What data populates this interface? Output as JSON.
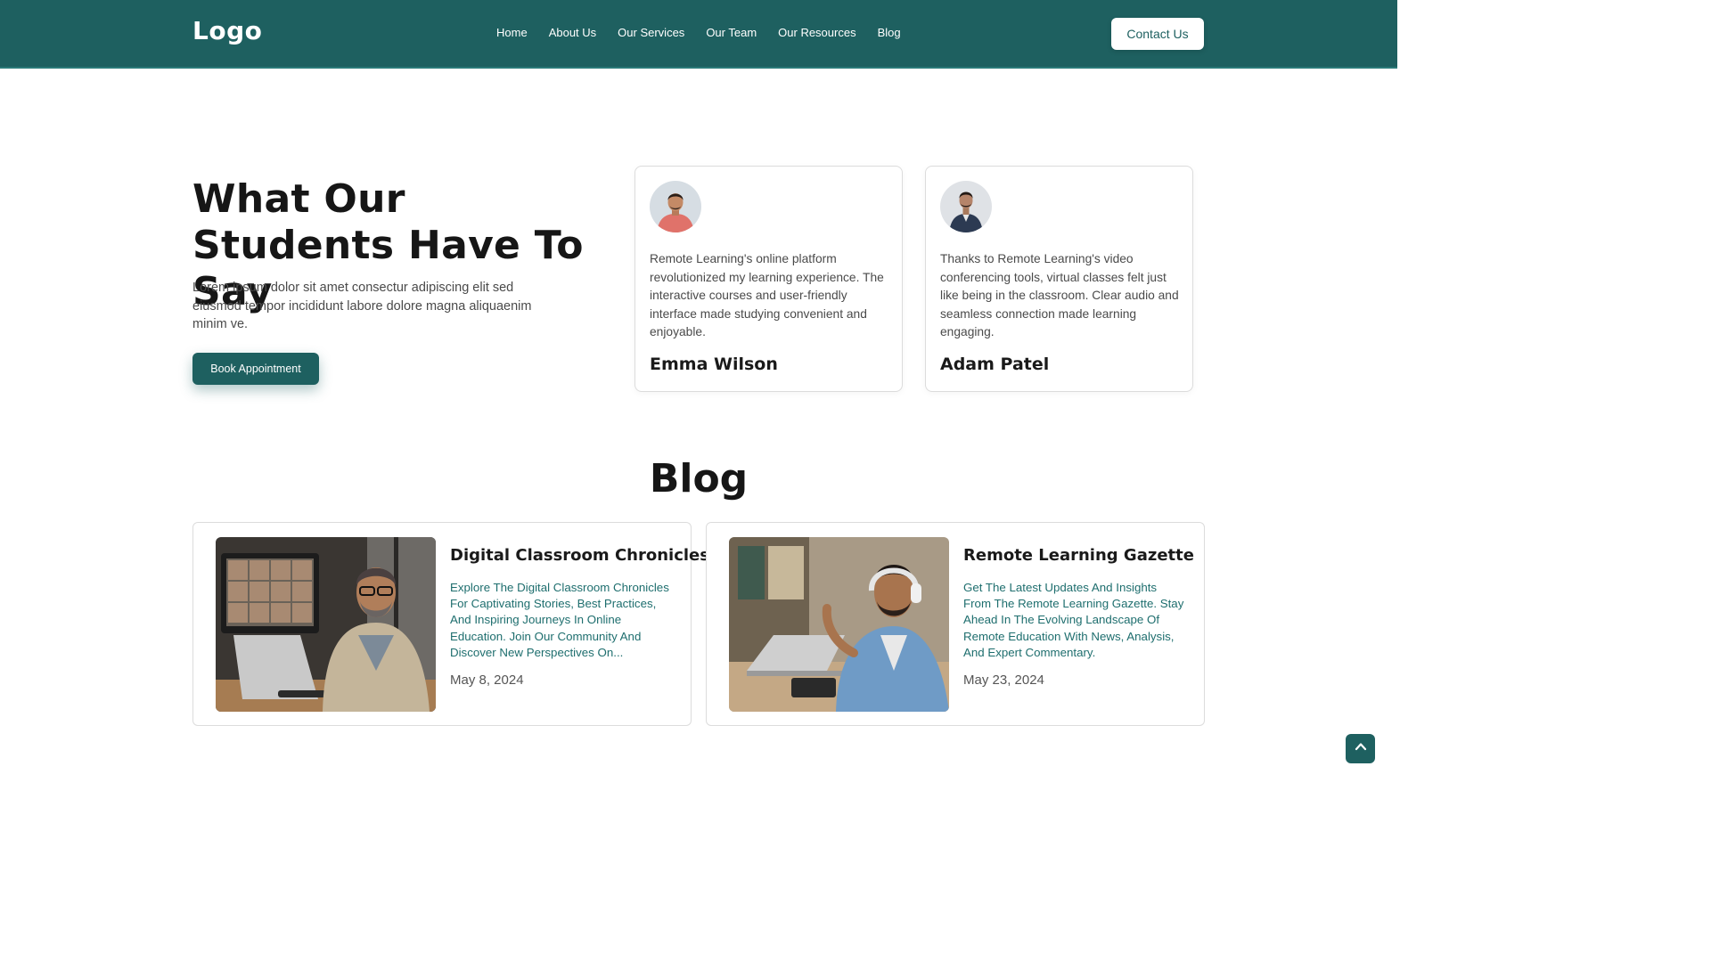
{
  "header": {
    "logo": "Logo",
    "nav": [
      "Home",
      "About Us",
      "Our Services",
      "Our Team",
      "Our Resources",
      "Blog"
    ],
    "contact_label": "Contact Us"
  },
  "testimonials": {
    "title": "What Our Students Have To Say",
    "description": "Lorem ipsum dolor sit amet consectur adipiscing elit sed eiusmod tempor incididunt labore dolore magna aliquaenim minim ve.",
    "button_label": "Book Appointment",
    "items": [
      {
        "quote": "Remote Learning's online platform revolutionized my learning experience. The interactive courses and user-friendly interface made studying convenient and enjoyable.",
        "name": "Emma Wilson"
      },
      {
        "quote": "Thanks to Remote Learning's video conferencing tools, virtual classes felt just like being in the classroom. Clear audio and seamless connection made learning engaging.",
        "name": "Adam Patel"
      }
    ]
  },
  "blog": {
    "title": "Blog",
    "posts": [
      {
        "title": "Digital Classroom Chronicles",
        "excerpt": "Explore The Digital Classroom Chronicles For Captivating Stories, Best Practices, And Inspiring Journeys In Online Education. Join Our Community And Discover New Perspectives On...",
        "date": "May 8, 2024"
      },
      {
        "title": "Remote Learning Gazette",
        "excerpt": "Get The Latest Updates And Insights From The Remote Learning Gazette. Stay Ahead In The Evolving Landscape Of Remote Education With News, Analysis, And Expert Commentary.",
        "date": "May 23, 2024"
      }
    ]
  },
  "colors": {
    "primary": "#1e6060",
    "link_text": "#1e6e6e"
  },
  "icons": {
    "scroll_top": "chevron-up-icon"
  }
}
